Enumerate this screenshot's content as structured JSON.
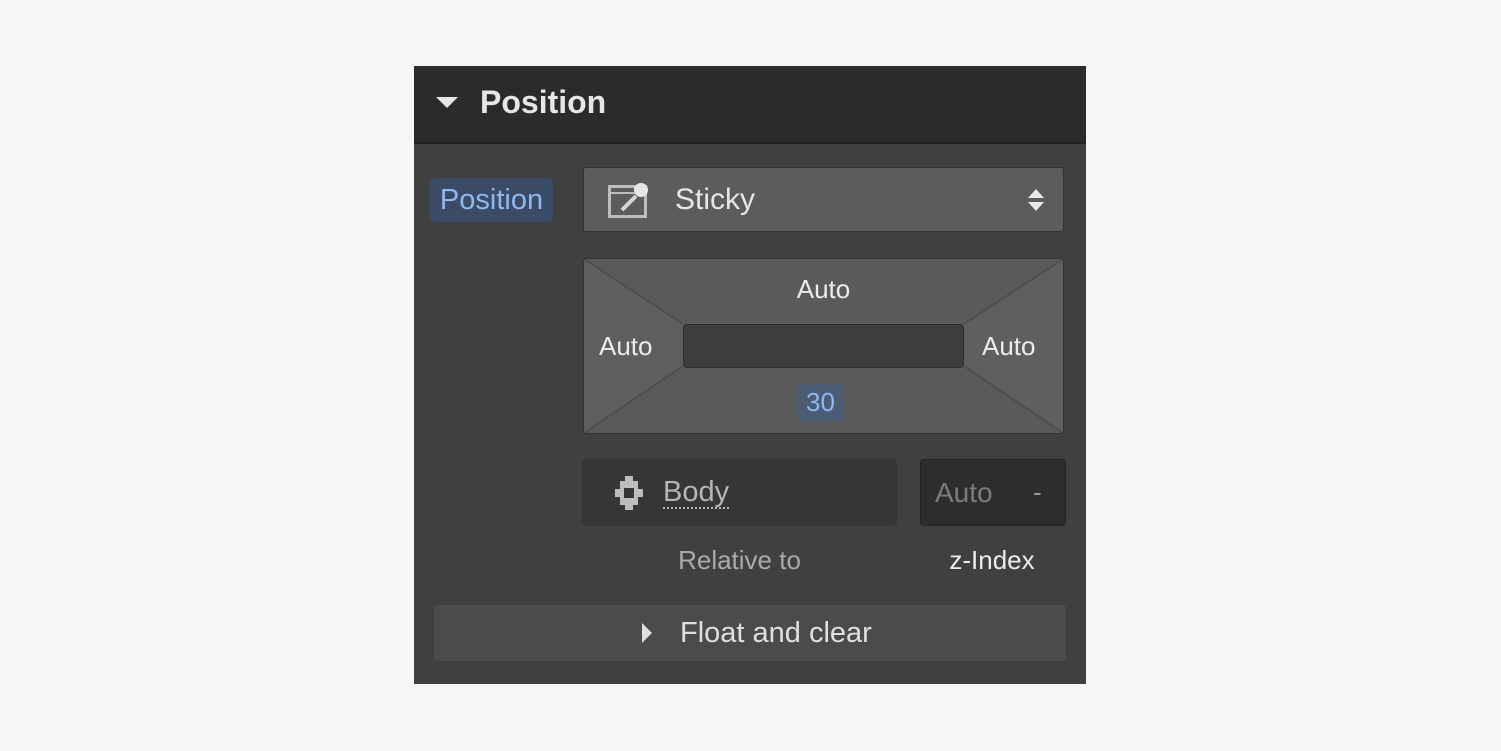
{
  "section": {
    "title": "Position",
    "expanded": true
  },
  "position": {
    "label": "Position",
    "select_value": "Sticky",
    "select_icon": "sticky-position-icon"
  },
  "offsets": {
    "top": "Auto",
    "left": "Auto",
    "right": "Auto",
    "bottom": "30"
  },
  "relative_to": {
    "value": "Body",
    "caption": "Relative to",
    "icon": "body-element-icon"
  },
  "z_index": {
    "value": "Auto",
    "stepper": "-",
    "caption": "z-Index"
  },
  "float_section": {
    "title": "Float and clear",
    "expanded": false
  },
  "colors": {
    "accent": "#8fb8ef",
    "panel": "#404040",
    "header": "#2b2b2b"
  }
}
